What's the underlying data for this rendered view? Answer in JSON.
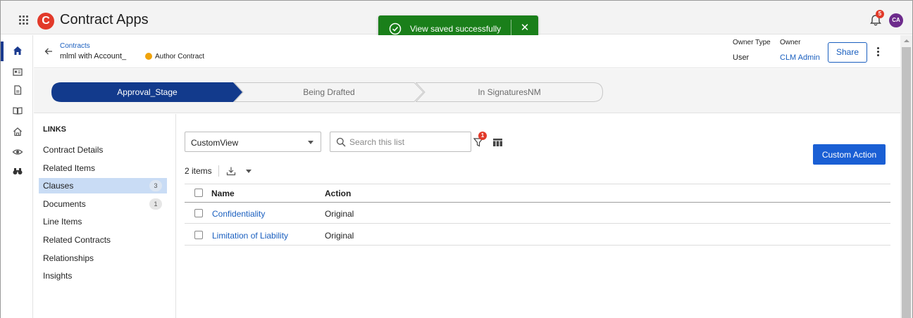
{
  "app": {
    "title": "Contract Apps",
    "logo_letter": "C",
    "notifications_count": "5",
    "avatar_initials": "CA"
  },
  "toast": {
    "message": "View saved successfully",
    "close_symbol": "✕",
    "color": "#1a7f1a"
  },
  "rail": {
    "icons": [
      "home-icon",
      "card-icon",
      "document-icon",
      "book-icon",
      "house-icon",
      "eye-icon",
      "binoculars-icon"
    ]
  },
  "header": {
    "breadcrumb": "Contracts",
    "record_title": "mlml  with  Account_",
    "status": "Author Contract",
    "status_color": "#f0a30a",
    "owner_type_label": "Owner Type",
    "owner_type_value": "User",
    "owner_label": "Owner",
    "owner_value": "CLM Admin",
    "share_label": "Share"
  },
  "stages": [
    {
      "label": "Approval_Stage",
      "active": true
    },
    {
      "label": "Being Drafted",
      "active": false
    },
    {
      "label": "In SignaturesNM",
      "active": false
    }
  ],
  "links": {
    "title": "LINKS",
    "items": [
      {
        "label": "Contract Details",
        "count": ""
      },
      {
        "label": "Related Items",
        "count": ""
      },
      {
        "label": "Clauses",
        "count": "3",
        "active": true
      },
      {
        "label": "Documents",
        "count": "1"
      },
      {
        "label": "Line Items",
        "count": ""
      },
      {
        "label": "Related Contracts",
        "count": ""
      },
      {
        "label": "Relationships",
        "count": ""
      },
      {
        "label": "Insights",
        "count": ""
      }
    ]
  },
  "list": {
    "view_name": "CustomView",
    "search_placeholder": "Search this list",
    "filter_count": "1",
    "custom_action_label": "Custom Action",
    "items_count": "2 items",
    "columns": [
      "Name",
      "Action"
    ],
    "rows": [
      {
        "name": "Confidentiality",
        "action": "Original"
      },
      {
        "name": "Limitation of Liability",
        "action": "Original"
      }
    ]
  },
  "colors": {
    "accent": "#1a5fd4",
    "active_stage": "#123a8c",
    "link": "#1a5fbf"
  }
}
